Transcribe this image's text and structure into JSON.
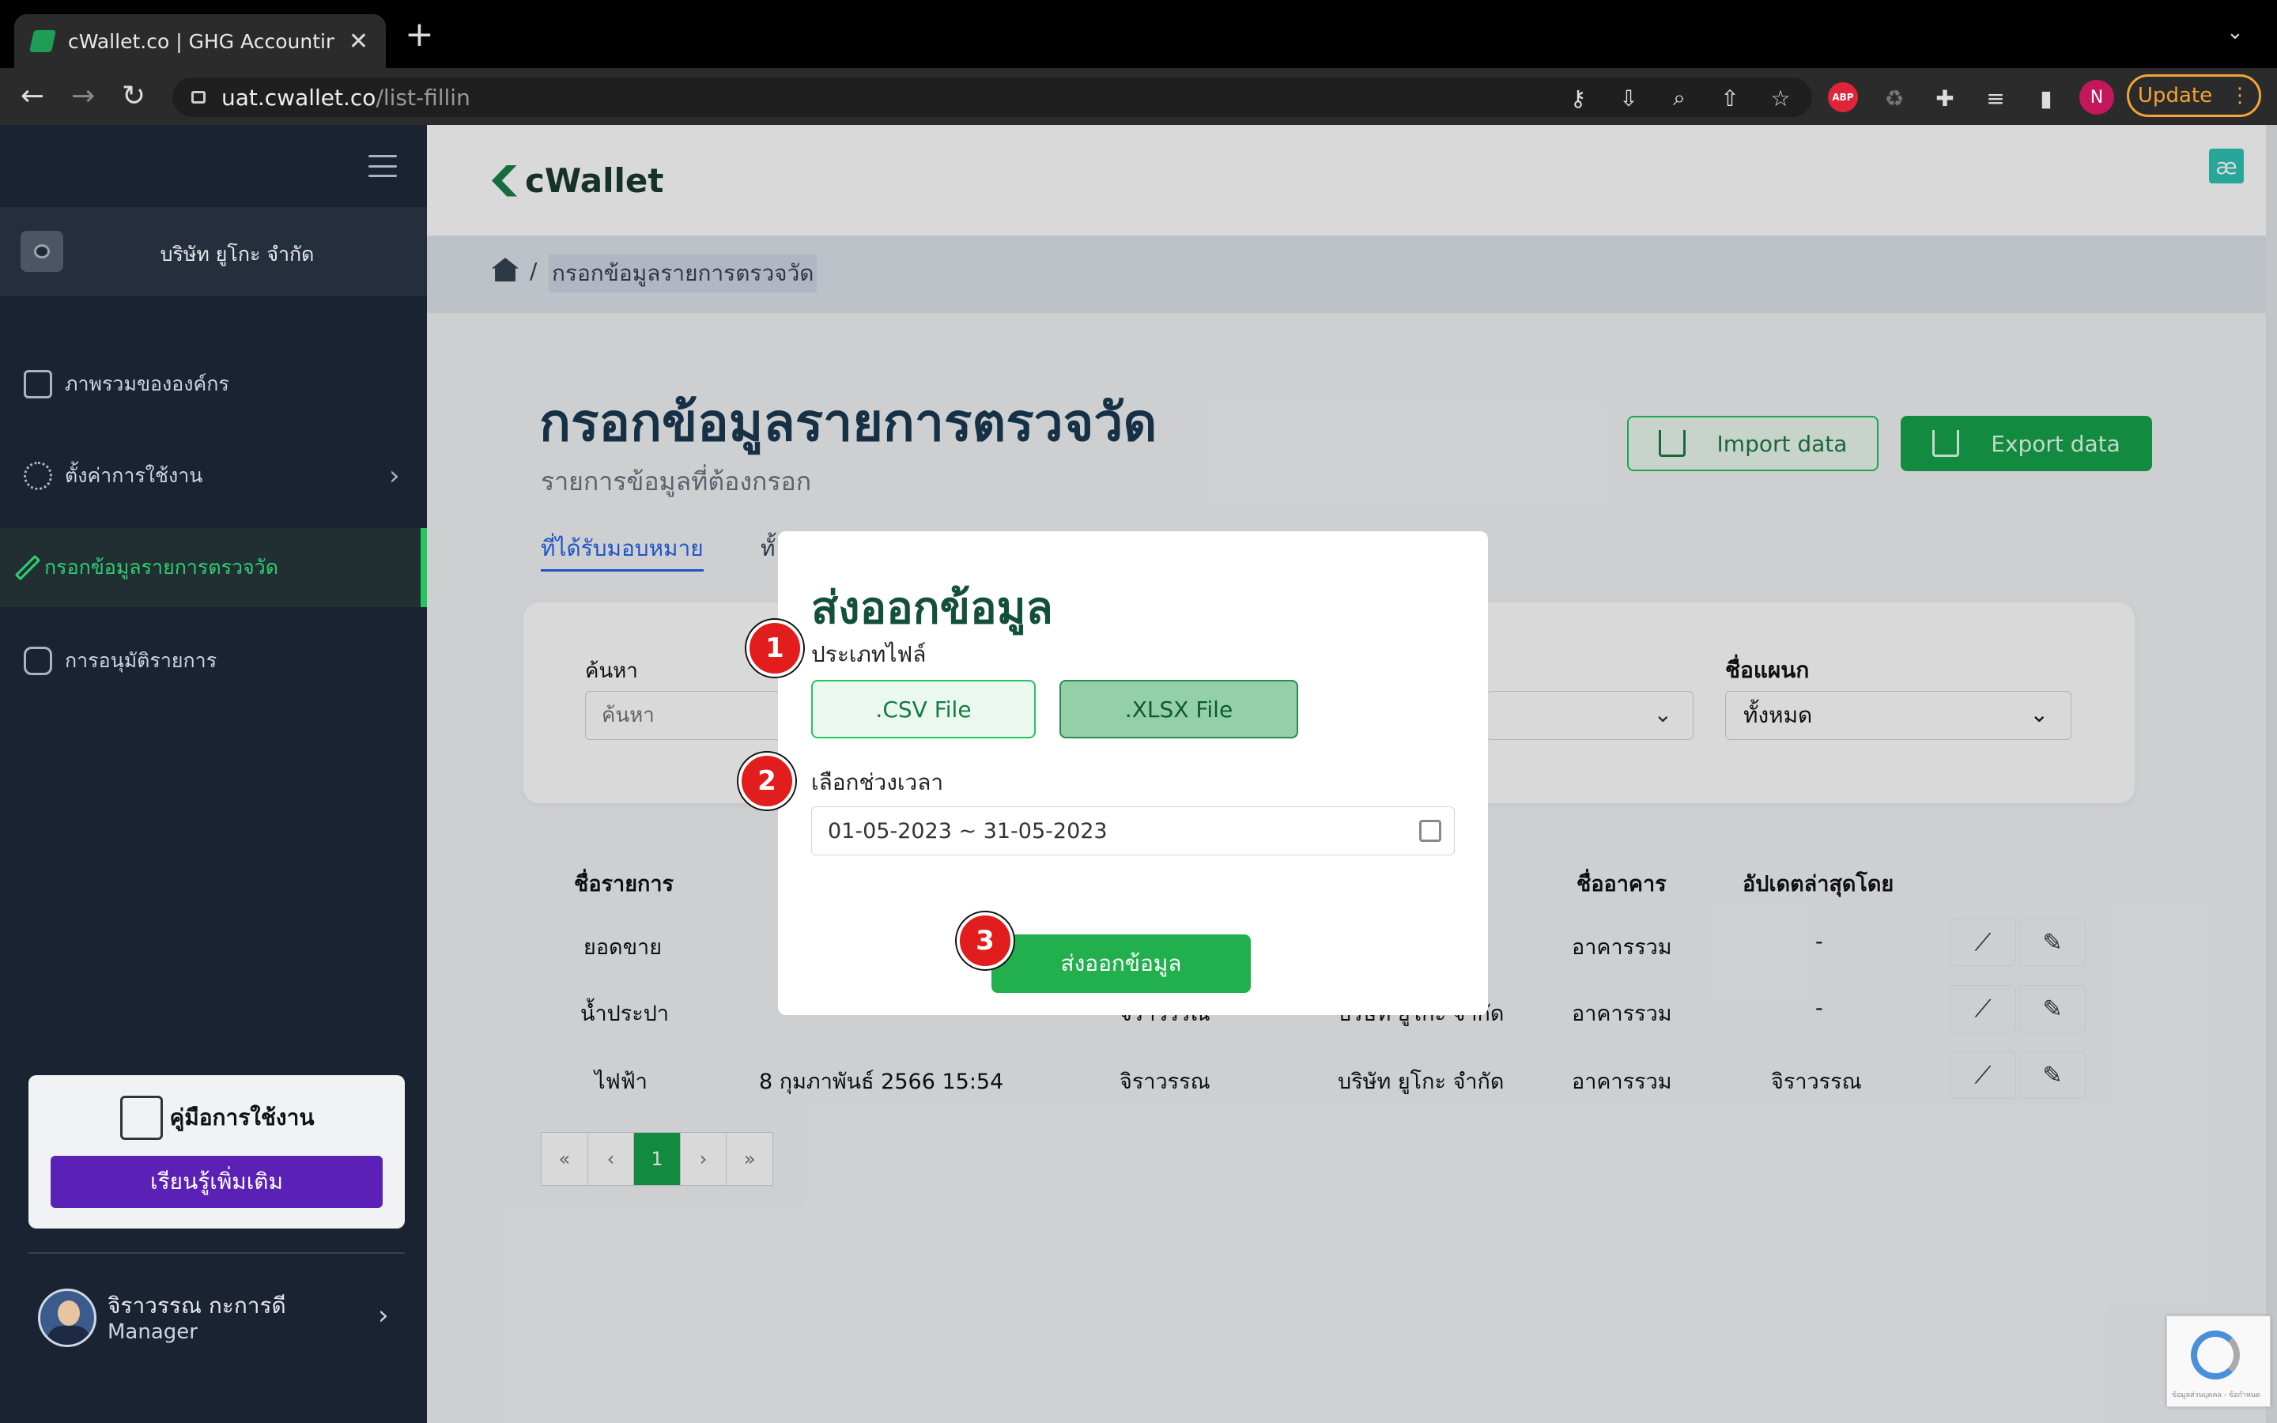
{
  "browser": {
    "tab_title": "cWallet.co | GHG Accounting S",
    "tab_close": "✕",
    "new_tab": "+",
    "url_host": "uat.cwallet.co",
    "url_path": "/list-fillin",
    "update_label": "Update",
    "profile_initial": "N",
    "abp_label": "ABP"
  },
  "sidebar": {
    "company": "บริษัท ยูโกะ จำกัด",
    "items": [
      {
        "label": "ภาพรวมขององค์กร",
        "icon": "layout-icon"
      },
      {
        "label": "ตั้งค่าการใช้งาน",
        "icon": "gear-icon"
      },
      {
        "label": "กรอกข้อมูลรายการตรวจวัด",
        "icon": "pencil-icon",
        "active": true
      },
      {
        "label": "การอนุมัติรายการ",
        "icon": "approval-icon"
      }
    ],
    "manual_title": "คู่มือการใช้งาน",
    "manual_button": "เรียนรู้เพิ่มเติม",
    "user_name": "จิราวรรณ กะการดี",
    "user_role": "Manager"
  },
  "header": {
    "logo_text": "cWallet",
    "ae_icon": "æ"
  },
  "breadcrumb": {
    "separator": "/",
    "current": "กรอกข้อมูลรายการตรวจวัด"
  },
  "page": {
    "title": "กรอกข้อมูลรายการตรวจวัด",
    "subtitle": "รายการข้อมูลที่ต้องกรอก",
    "import_label": "Import data",
    "export_label": "Export data",
    "tab_assigned": "ที่ได้รับมอบหมาย",
    "tab_all_partial": "ทั้"
  },
  "filters": {
    "search_label": "ค้นหา",
    "search_placeholder": "ค้นหา",
    "dept_label": "ชื่อแผนก",
    "dept_value": "ทั้งหมด"
  },
  "table": {
    "headers": [
      "ชื่อรายการ",
      "ชื่ออาคาร",
      "อัปเดตล่าสุดโดย"
    ],
    "rows": [
      {
        "name": "ยอดขาย",
        "date": "",
        "user": "",
        "company_partial": "ด",
        "building": "อาคารรวม",
        "updated_by": "-"
      },
      {
        "name": "น้ำประปา",
        "date": "",
        "user": "จิราวรรณ",
        "company_partial": "บริษัท ยูโกะ จำกัด",
        "building": "อาคารรวม",
        "updated_by": "-"
      },
      {
        "name": "ไฟฟ้า",
        "date": "8 กุมภาพันธ์ 2566 15:54",
        "user": "จิราวรรณ",
        "company": "บริษัท ยูโกะ จำกัด",
        "building": "อาคารรวม",
        "updated_by": "จิราวรรณ"
      }
    ]
  },
  "pagination": {
    "first": "«",
    "prev": "‹",
    "current": "1",
    "next": "›",
    "last": "»"
  },
  "modal": {
    "title": "ส่งออกข้อมูล",
    "file_type_label": "ประเภทไฟล์",
    "csv_label": ".CSV File",
    "xlsx_label": ".XLSX File",
    "selected_type": ".XLSX File",
    "period_label": "เลือกช่วงเวลา",
    "date_range": "01-05-2023 ~ 31-05-2023",
    "submit_label": "ส่งออกข้อมูล"
  },
  "steps": [
    "1",
    "2",
    "3"
  ],
  "recaptcha_text": "ข้อมูลส่วนบุคคล - ข้อกำหนด",
  "colors": {
    "sidebar_bg": "#1a2331",
    "brand_green": "#16a34a",
    "title_blue": "#1a3a52",
    "step_red": "#e11d1d",
    "learn_purple": "#5b21b6"
  }
}
